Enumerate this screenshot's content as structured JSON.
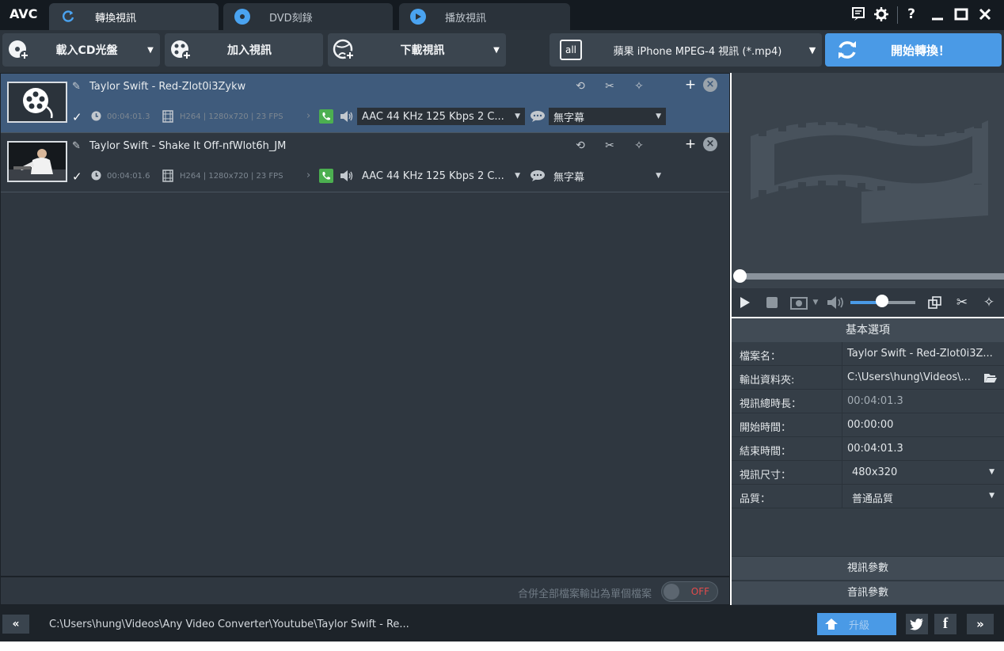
{
  "app": {
    "logo": "AVC",
    "tabs": [
      {
        "label": "轉換視訊",
        "icon": "refresh-icon",
        "active": true
      },
      {
        "label": "DVD刻錄",
        "icon": "disc-icon",
        "active": false
      },
      {
        "label": "播放視訊",
        "icon": "play-circle-icon",
        "active": false
      }
    ],
    "window": {
      "help": "?"
    }
  },
  "toolbar": {
    "load_cd": "載入CD光盤",
    "add_video": "加入視訊",
    "download_video": "下載視訊",
    "profile_badge": "all",
    "profile": "蘋果 iPhone MPEG-4 視訊 (*.mp4)",
    "start": "開始轉換！",
    "accent_color": "#4a9ae6"
  },
  "files": [
    {
      "title": "Taylor Swift - Red-Zlot0i3Zykw",
      "duration": "00:04:01.3",
      "video_info": "H264 | 1280x720 | 23 FPS",
      "audio": "AAC 44 KHz 125 Kbps 2 C...",
      "subtitle": "無字幕",
      "selected": true,
      "checked": true
    },
    {
      "title": "Taylor Swift - Shake It Off-nfWlot6h_JM",
      "duration": "00:04:01.6",
      "video_info": "H264 | 1280x720 | 23 FPS",
      "audio": "AAC 44 KHz 125 Kbps 2 C...",
      "subtitle": "無字幕",
      "selected": false,
      "checked": true
    }
  ],
  "merge": {
    "label": "合併全部檔案輸出為單個檔案",
    "toggle": "OFF"
  },
  "options": {
    "header": "基本選項",
    "rows": [
      {
        "key": "檔案名：",
        "value": "Taylor Swift - Red-Zlot0i3Z..."
      },
      {
        "key": "輸出資料夾:",
        "value": "C:\\Users\\hung\\Videos\\..."
      },
      {
        "key": "視訊總時長：",
        "value": "00:04:01.3"
      },
      {
        "key": "開始時間：",
        "value": "00:00:00"
      },
      {
        "key": "結束時間：",
        "value": "00:04:01.3"
      },
      {
        "key": "視訊尺寸：",
        "value": "480x320"
      },
      {
        "key": "品質：",
        "value": "普通品質"
      }
    ],
    "video_params": "視訊參數",
    "audio_params": "音訊參數"
  },
  "statusbar": {
    "path": "C:\\Users\\hung\\Videos\\Any Video Converter\\Youtube\\Taylor Swift - Re...",
    "upgrade": "升級",
    "facebook": "f"
  }
}
